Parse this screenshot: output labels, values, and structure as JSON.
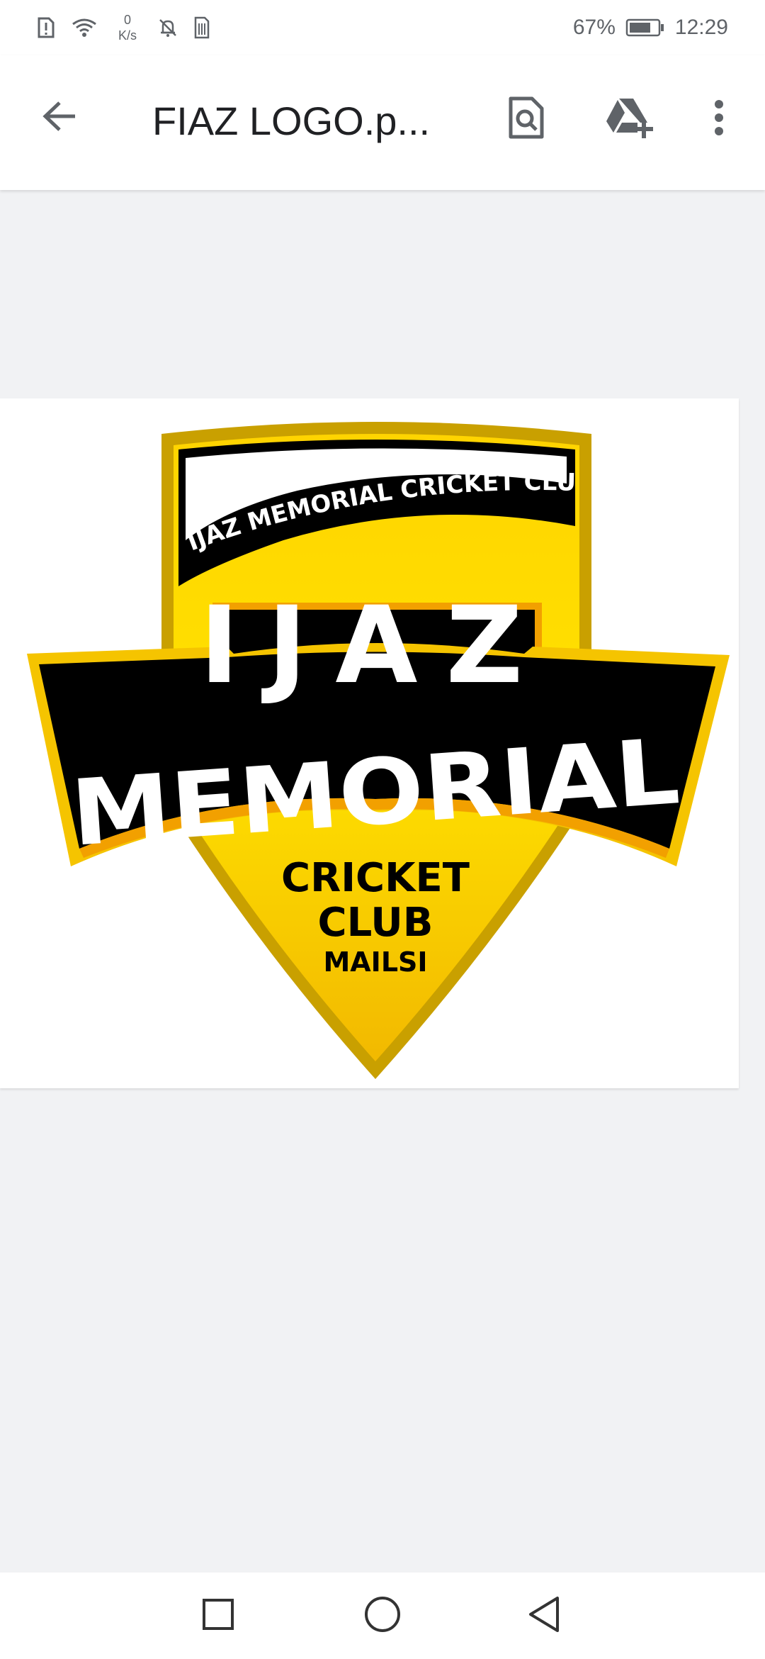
{
  "status_bar": {
    "netspeed_value": "0",
    "netspeed_unit": "K/s",
    "battery": "67%",
    "time": "12:29",
    "icons": [
      "alert-icon",
      "wifi-icon",
      "notifications-off-icon",
      "sim-icon",
      "battery-icon"
    ]
  },
  "app_bar": {
    "title": "FIAZ LOGO.p...",
    "actions": [
      "back-arrow-icon",
      "document-search-icon",
      "drive-add-icon",
      "more-vertical-icon"
    ]
  },
  "logo": {
    "arc_text": "IJAZ MEMORIAL CRICKET CLUB",
    "name_top": "IJAZ",
    "name_main": "MEMORIAL",
    "sub1": "CRICKET",
    "sub2": "CLUB",
    "sub3": "MAILSI",
    "colors": {
      "gold": "#f5c400",
      "gold_dark": "#c9a000",
      "black": "#000000",
      "white": "#ffffff"
    }
  },
  "nav_bar": {
    "icons": [
      "recents-square-icon",
      "home-circle-icon",
      "back-triangle-icon"
    ]
  }
}
